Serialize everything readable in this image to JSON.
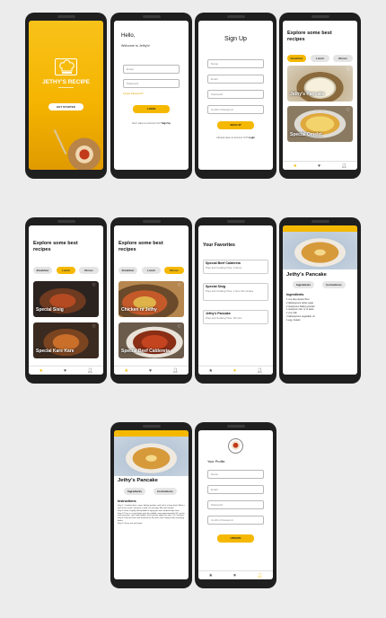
{
  "splash": {
    "title": "JETHY'S RECIPE",
    "button": "GET STARTED"
  },
  "login": {
    "hello": "Hello,",
    "welcome": "Welcome to Jethy's!",
    "email_placeholder": "Email",
    "password_placeholder": "Password",
    "forgot": "Forgot Password?",
    "login_button": "LOGIN",
    "no_account": "Don't Have an Account Yet?",
    "signup_link": "Sign Up"
  },
  "signup": {
    "title": "Sign Up",
    "name_placeholder": "Name",
    "email_placeholder": "Email",
    "password_placeholder": "Password",
    "confirm_placeholder": "Confirm Password",
    "button": "SIGN UP",
    "have_account": "Already Have an Account Yet?",
    "login_link": "Login"
  },
  "explore": {
    "heading": "Explore some best recipes",
    "filters": [
      "Breakfast",
      "Lunch",
      "Dinner"
    ],
    "breakfast_cards": [
      "Jethy's Pancake",
      "Special Omelet"
    ],
    "lunch_cards": [
      "Special Sisig",
      "Special Kare Kare"
    ],
    "dinner_cards": [
      "Chicken ni Jethy",
      "Special Beef Caldereta"
    ]
  },
  "favorites": {
    "heading": "Your Favorites",
    "items": [
      {
        "name": "Special Beef Caldereta",
        "detail": "Prep and Cooking Time: 2 hours"
      },
      {
        "name": "Special Sisig",
        "detail": "Prep and Cooking Time: 1 hour 40 minutes"
      },
      {
        "name": "Jethy's Pancake",
        "detail": "Prep and Cooking Time: 30 mins"
      }
    ]
  },
  "recipe": {
    "name": "Jethy's Pancake",
    "tabs": [
      "Ingredients",
      "Instructions"
    ],
    "ingredients_heading": "Ingredients",
    "ingredients": [
      "1 cup all-purpose flour",
      "2 tablespoons white sugar",
      "2 teaspoons baking powder",
      "1 teaspoon salt, or to taste",
      "1 cup milk",
      "3 tablespoons vegetable oil",
      "1 egg, beaten"
    ],
    "instructions_heading": "Instructions",
    "instructions": [
      "Step 1: Combine flour, sugar, baking powder, and salt in a large bowl. Make a well in the center, and pour in milk, oil, and egg. Mix until smooth.",
      "Step 2: Heat a lightly oiled griddle or frying pan over medium-high heat.",
      "Step 3: Pour or scoop batter onto the griddle, using approximately 1/4 cup for each pancake; cook until bubbles form and the edges are dry, 1 to 2 minutes.",
      "Step 4: Flip and cook until browned on the other side. Repeat with remaining batter.",
      "Step 5: Serve hot and enjoy!"
    ]
  },
  "profile": {
    "heading": "Your Profile",
    "name_placeholder": "Name",
    "email_placeholder": "Email",
    "password_placeholder": "Password",
    "confirm_placeholder": "Confirm Password",
    "button": "UPDATE"
  },
  "colors": {
    "accent": "#f5b800",
    "background": "#ececec",
    "phone": "#1f1f1f"
  },
  "icons": [
    "chef-hat-logo-icon",
    "star-icon",
    "heart-icon",
    "person-icon",
    "back-arrow-icon",
    "avatar-logo-icon"
  ]
}
